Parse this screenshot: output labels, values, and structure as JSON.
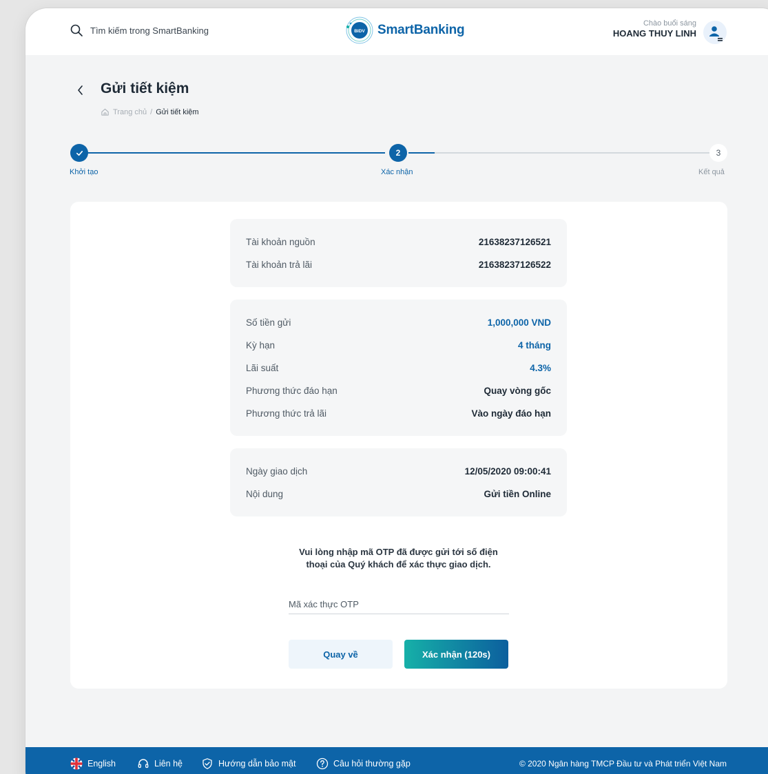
{
  "header": {
    "search_placeholder": "Tìm kiếm trong SmartBanking",
    "logo_badge": "BIDV",
    "logo_text": "SmartBanking",
    "greeting": "Chào buổi sáng",
    "user_name": "HOANG THUY LINH"
  },
  "page": {
    "title": "Gửi tiết kiệm",
    "breadcrumb": {
      "home": "Trang chủ",
      "separator": "/",
      "current": "Gửi tiết kiệm"
    }
  },
  "stepper": {
    "steps": [
      {
        "label": "Khởi tạo",
        "number": "1",
        "state": "done"
      },
      {
        "label": "Xác nhận",
        "number": "2",
        "state": "active"
      },
      {
        "label": "Kết quả",
        "number": "3",
        "state": "todo"
      }
    ]
  },
  "details": {
    "accounts": [
      {
        "label": "Tài khoản nguồn",
        "value": "21638237126521"
      },
      {
        "label": "Tài khoản trả lãi",
        "value": "21638237126522"
      }
    ],
    "deposit": [
      {
        "label": "Số tiền gửi",
        "value": "1,000,000 VND"
      },
      {
        "label": "Kỳ hạn",
        "value": "4 tháng"
      },
      {
        "label": "Lãi suất",
        "value": "4.3%"
      },
      {
        "label": "Phương thức đáo hạn",
        "value": "Quay vòng gốc"
      },
      {
        "label": "Phương thức trả lãi",
        "value": "Vào ngày đáo hạn"
      }
    ],
    "transaction": [
      {
        "label": "Ngày giao dịch",
        "value": "12/05/2020 09:00:41"
      },
      {
        "label": "Nội dung",
        "value": "Gửi tiền Online"
      }
    ]
  },
  "otp": {
    "message_line1": "Vui lòng nhập mã OTP đã được gửi tới số điện",
    "message_line2": "thoại của Quý khách để xác thực giao dịch.",
    "placeholder": "Mã xác thực OTP",
    "back_label": "Quay về",
    "confirm_label": "Xác nhận (120s)"
  },
  "footer": {
    "language": "English",
    "contact": "Liên hệ",
    "security_guide": "Hướng dẫn bảo mật",
    "faq": "Câu hỏi thường gặp",
    "copyright": "© 2020 Ngân hàng TMCP Đầu tư và Phát triển Việt Nam"
  },
  "colors": {
    "primary": "#0d64a8",
    "accent_teal": "#16b0a8",
    "card_bg": "#ffffff",
    "page_bg": "#f3f4f5"
  },
  "icons": [
    "search-icon",
    "bidv-logo-icon",
    "user-menu-icon",
    "back-chevron-icon",
    "home-icon",
    "check-icon",
    "uk-flag-icon",
    "headset-icon",
    "shield-check-icon",
    "help-circle-icon"
  ]
}
